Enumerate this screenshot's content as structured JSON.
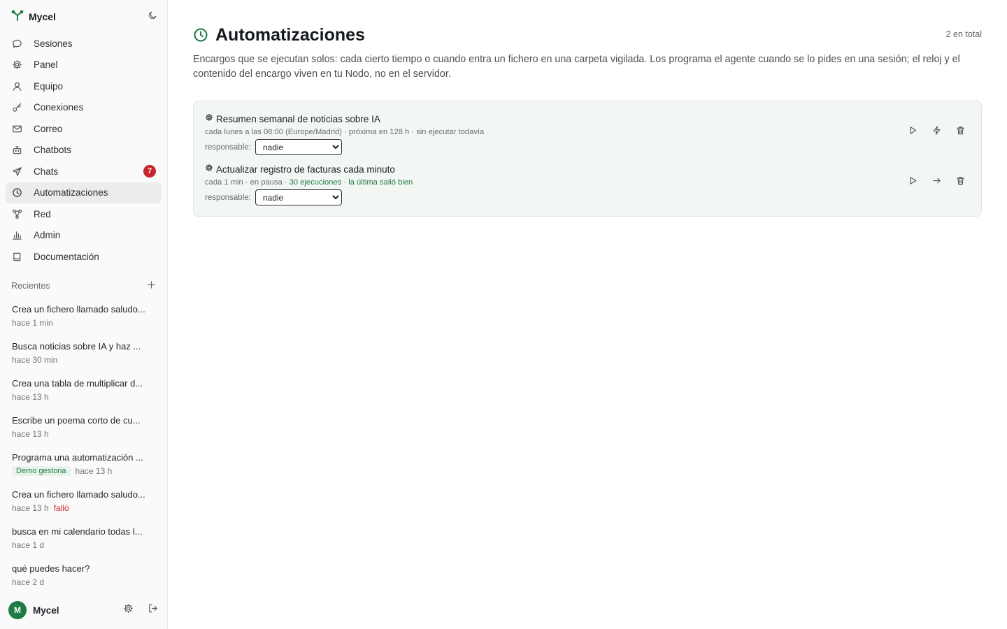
{
  "app": {
    "name": "Mycel"
  },
  "nav": [
    {
      "id": "sessions",
      "label": "Sesiones",
      "icon": "chat-bubble-icon"
    },
    {
      "id": "panel",
      "label": "Panel",
      "icon": "gear-icon"
    },
    {
      "id": "team",
      "label": "Equipo",
      "icon": "user-icon"
    },
    {
      "id": "connections",
      "label": "Conexiones",
      "icon": "key-icon"
    },
    {
      "id": "mail",
      "label": "Correo",
      "icon": "mail-icon"
    },
    {
      "id": "chatbots",
      "label": "Chatbots",
      "icon": "bot-icon"
    },
    {
      "id": "chats",
      "label": "Chats",
      "icon": "send-icon",
      "badge": "7"
    },
    {
      "id": "automations",
      "label": "Automatizaciones",
      "icon": "clock-icon",
      "active": true
    },
    {
      "id": "network",
      "label": "Red",
      "icon": "network-icon"
    },
    {
      "id": "admin",
      "label": "Admin",
      "icon": "bar-chart-icon"
    },
    {
      "id": "docs",
      "label": "Documentación",
      "icon": "book-icon"
    }
  ],
  "recent": {
    "title": "Recientes",
    "items": [
      {
        "text": "Crea un fichero llamado saludo...",
        "time": "hace 1 min"
      },
      {
        "text": "Busca noticias sobre IA y haz ...",
        "time": "hace 30 min"
      },
      {
        "text": "Crea una tabla de multiplicar d...",
        "time": "hace 13 h"
      },
      {
        "text": "Escribe un poema corto de cu...",
        "time": "hace 13 h"
      },
      {
        "text": "Programa una automatización ...",
        "tag": "Demo gestoria",
        "time": "hace 13 h"
      },
      {
        "text": "Crea un fichero llamado saludo...",
        "time": "hace 13 h",
        "status": "falló"
      },
      {
        "text": "busca en mi calendario todas l...",
        "time": "hace 1 d"
      },
      {
        "text": "qué puedes hacer?",
        "time": "hace 2 d"
      }
    ]
  },
  "user": {
    "initial": "M",
    "name": "Mycel"
  },
  "main": {
    "title": "Automatizaciones",
    "total": "2 en total",
    "description": "Encargos que se ejecutan solos: cada cierto tiempo o cuando entra un fichero en una carpeta vigilada. Los programa el agente cuando se lo pides en una sesión; el reloj y el contenido del encargo viven en tu Nodo, no en el servidor.",
    "automations": [
      {
        "name": "Resumen semanal de noticias sobre IA",
        "schedule": "cada lunes a las 08:00 (Europe/Madrid) · próxima en 128 h · sin ejecutar todavía",
        "schedule_ok": "",
        "responsable_label": "responsable:",
        "responsable": "nadie",
        "second_action_icon": "bolt-icon"
      },
      {
        "name": "Actualizar registro de facturas cada minuto",
        "schedule": "cada 1 min · en pausa · ",
        "schedule_ok": "30 ejecuciones · la última salió bien",
        "responsable_label": "responsable:",
        "responsable": "nadie",
        "second_action_icon": "arrow-right-icon"
      }
    ]
  },
  "colors": {
    "accent": "#1f7a43",
    "badge": "#c9252d",
    "panel_bg": "#f2f7f4",
    "sidebar_bg": "#fafafa"
  }
}
